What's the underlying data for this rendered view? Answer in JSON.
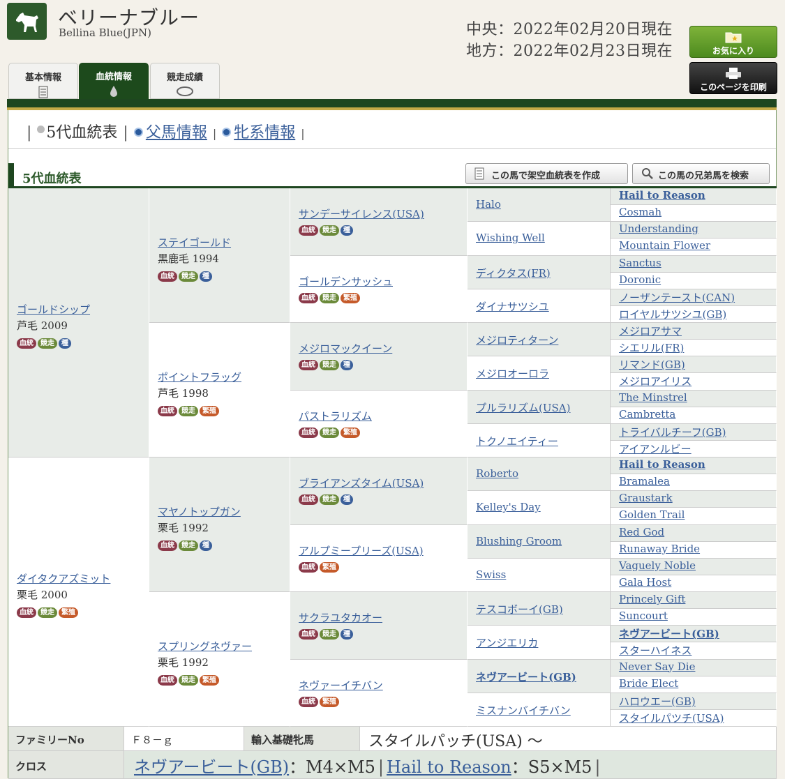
{
  "header": {
    "name": "ベリーナブルー",
    "name_en": "Bellina Blue(JPN)",
    "date_central": "中央：2022年02月20日現在",
    "date_local": "地方：2022年02月23日現在",
    "fav_label": "お気に入り",
    "print_label": "このページを印刷"
  },
  "tabs": [
    {
      "label": "基本情報"
    },
    {
      "label": "血統情報"
    },
    {
      "label": "競走成績"
    }
  ],
  "subnav": {
    "current": "5代血統表",
    "sire_link": "父馬情報",
    "dam_link": "牝系情報"
  },
  "section": {
    "title": "5代血統表",
    "btn_create": "この馬で架空血統表を作成",
    "btn_search": "この馬の兄弟馬を検索"
  },
  "badges": {
    "blood": "血統",
    "race": "競走",
    "stud": "種",
    "breed": "繁殖"
  },
  "pedigree": {
    "g1": [
      {
        "name": "ゴールドシップ",
        "info": "芦毛 2009"
      },
      {
        "name": "ダイタクアズミット",
        "info": "栗毛 2000"
      }
    ],
    "g2": [
      {
        "name": "ステイゴールド",
        "info": "黒鹿毛 1994"
      },
      {
        "name": "ポイントフラッグ",
        "info": "芦毛 1998"
      },
      {
        "name": "マヤノトップガン",
        "info": "栗毛 1992"
      },
      {
        "name": "スプリングネヴァー",
        "info": "栗毛 1992"
      }
    ],
    "g3": [
      {
        "name": "サンデーサイレンス(USA)"
      },
      {
        "name": "ゴールデンサッシュ"
      },
      {
        "name": "メジロマックイーン"
      },
      {
        "name": "パストラリズム"
      },
      {
        "name": "ブライアンズタイム(USA)"
      },
      {
        "name": "アルプミープリーズ(USA)"
      },
      {
        "name": "サクラユタカオー"
      },
      {
        "name": "ネヴァーイチバン"
      }
    ],
    "g4": [
      "Halo",
      "Wishing Well",
      "ディクタス(FR)",
      "ダイナサツシユ",
      "メジロティターン",
      "メジロオーロラ",
      "プルラリズム(USA)",
      "トクノエイティー",
      "Roberto",
      "Kelley's Day",
      "Blushing Groom",
      "Swiss",
      "テスコボーイ(GB)",
      "アンジエリカ",
      "ネヴアービート(GB)",
      "ミスナンバイチバン"
    ],
    "g5": [
      "Hail to Reason",
      "Cosmah",
      "Understanding",
      "Mountain Flower",
      "Sanctus",
      "Doronic",
      "ノーザンテースト(CAN)",
      "ロイヤルサツシユ(GB)",
      "メジロアサマ",
      "シエリル(FR)",
      "リマンド(GB)",
      "メジロアイリス",
      "The Minstrel",
      "Cambretta",
      "トライバルチーフ(GB)",
      "アイアンルビー",
      "Hail to Reason",
      "Bramalea",
      "Graustark",
      "Golden Trail",
      "Red God",
      "Runaway Bride",
      "Vaguely Noble",
      "Gala Host",
      "Princely Gift",
      "Suncourt",
      "ネヴアービート(GB)",
      "スターハイネス",
      "Never Say Die",
      "Bride Elect",
      "ハロウエー(GB)",
      "スタイルパツチ(USA)"
    ]
  },
  "bottom": {
    "family_label": "ファミリーNo",
    "family_value": "Ｆ８－ｇ",
    "import_label": "輸入基礎牝馬",
    "import_value": "スタイルパッチ(USA) 〜",
    "cross_label": "クロス",
    "cross1_name": "ネヴアービート(GB)",
    "cross1_val": "：M4×M5",
    "cross2_name": "Hail to Reason",
    "cross2_val": "：S5×M5"
  }
}
